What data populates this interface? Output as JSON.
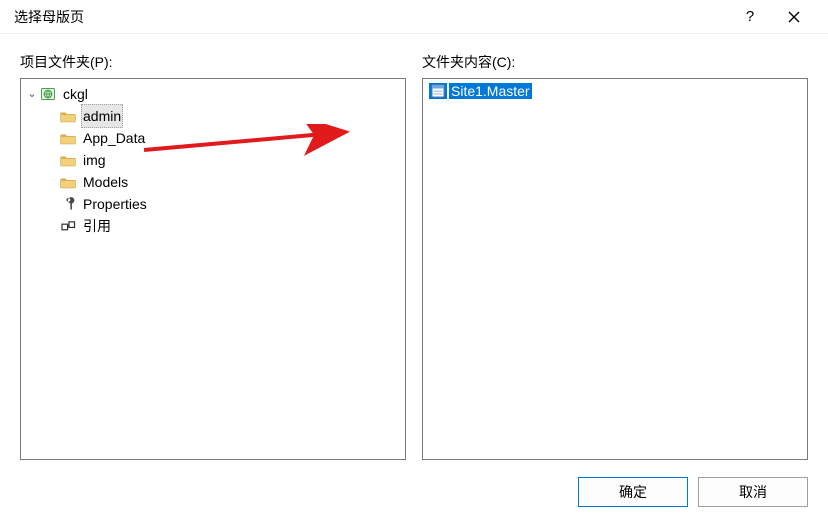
{
  "dialog": {
    "title": "选择母版页",
    "left_label": "项目文件夹(P):",
    "right_label": "文件夹内容(C):"
  },
  "tree": {
    "root": "ckgl",
    "children": {
      "0": "admin",
      "1": "App_Data",
      "2": "img",
      "3": "Models",
      "4": "Properties",
      "5": "引用"
    }
  },
  "list": {
    "0": "Site1.Master"
  },
  "buttons": {
    "ok": "确定",
    "cancel": "取消"
  }
}
